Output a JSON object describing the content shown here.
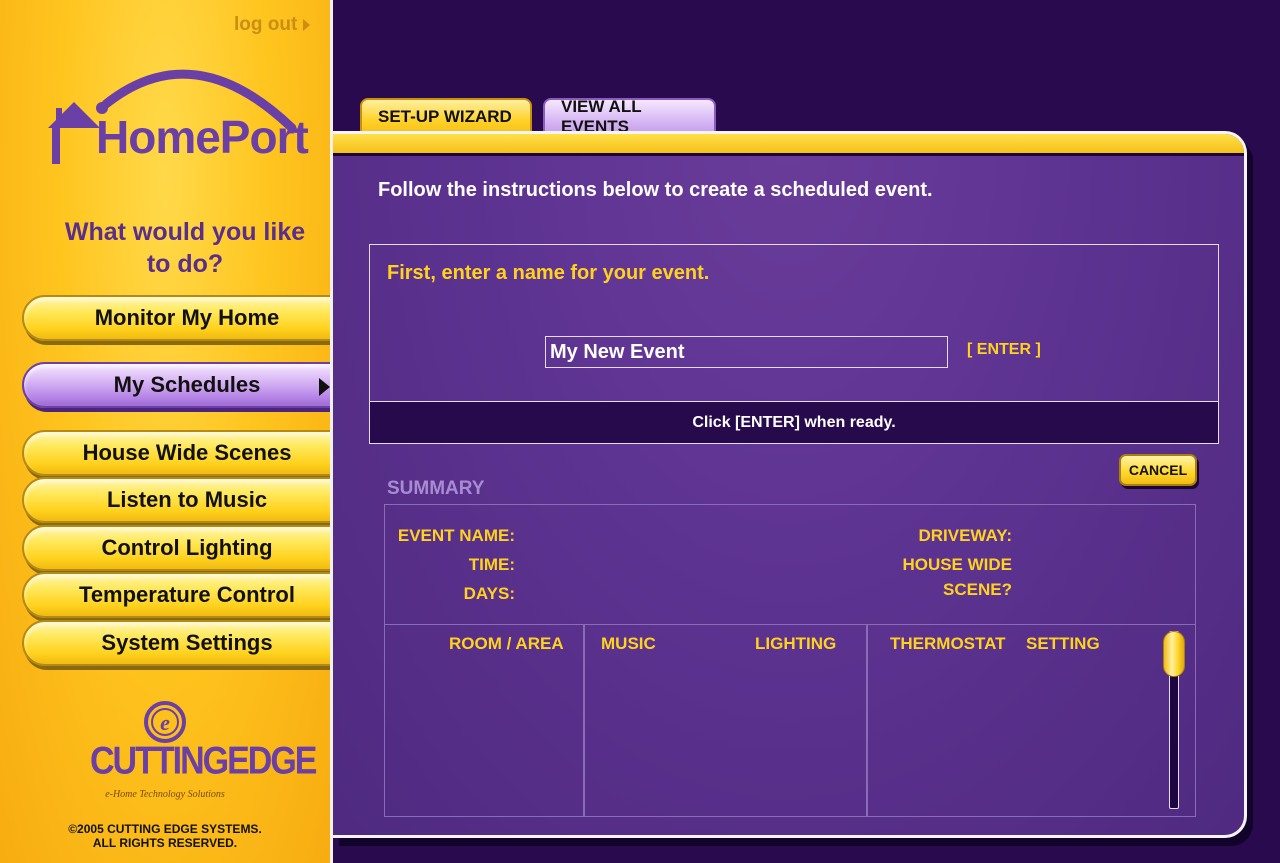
{
  "app": {
    "name": "HomePort"
  },
  "header": {
    "logout_label": "log out"
  },
  "sidebar": {
    "prompt": "What would you like to do?",
    "items": [
      {
        "label": "Monitor My Home"
      },
      {
        "label": "My Schedules",
        "active": true
      },
      {
        "label": "House Wide Scenes"
      },
      {
        "label": "Listen to Music"
      },
      {
        "label": "Control Lighting"
      },
      {
        "label": "Temperature Control"
      },
      {
        "label": "System Settings"
      }
    ],
    "company_logo_text": "CUTTINGEDGE",
    "company_tagline": "e-Home Technology Solutions",
    "copyright_line1": "©2005 CUTTING EDGE SYSTEMS.",
    "copyright_line2": "ALL RIGHTS RESERVED."
  },
  "tabs": [
    {
      "label": "SET-UP WIZARD",
      "active": true
    },
    {
      "label": "VIEW ALL EVENTS"
    }
  ],
  "main": {
    "instruction": "Follow the instructions below to create a scheduled event.",
    "name_prompt": "First, enter a name for your event.",
    "event_name_value": "My New Event",
    "enter_label": "[ ENTER ]",
    "ready_text": "Click [ENTER] when ready.",
    "cancel_label": "CANCEL"
  },
  "summary": {
    "title": "SUMMARY",
    "event_name_label": "EVENT NAME:",
    "time_label": "TIME:",
    "days_label": "DAYS:",
    "driveway_label": "DRIVEWAY:",
    "house_wide_label_1": "HOUSE WIDE",
    "house_wide_label_2": "SCENE?",
    "columns": [
      "ROOM / AREA",
      "MUSIC",
      "LIGHTING",
      "THERMOSTAT",
      "SETTING"
    ]
  },
  "colors": {
    "brand_purple": "#6a3fa6",
    "panel_purple": "#5d3391",
    "accent_yellow": "#ffd21e",
    "background": "#2a0a4e"
  }
}
